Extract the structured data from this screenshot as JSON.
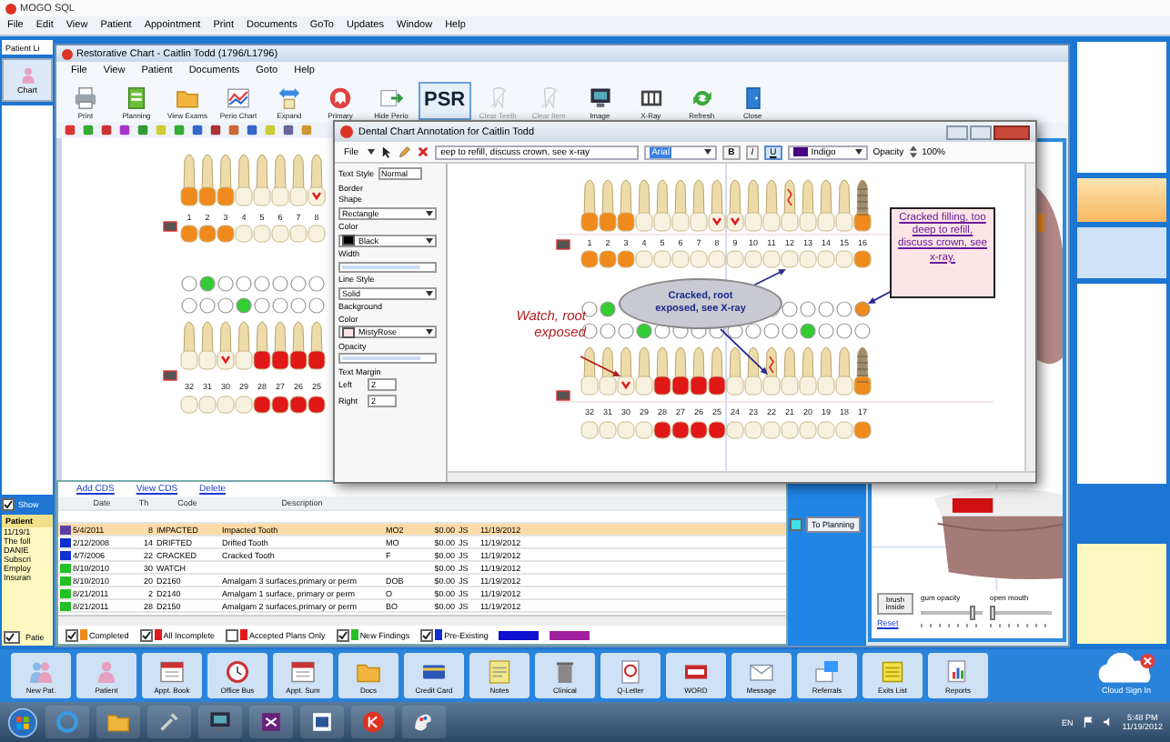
{
  "app": {
    "title": "MOGO SQL",
    "menu": [
      "File",
      "Edit",
      "View",
      "Patient",
      "Appointment",
      "Print",
      "Documents",
      "GoTo",
      "Updates",
      "Window",
      "Help"
    ],
    "side_tab": "Patient Li",
    "chart_button": "Chart",
    "show": {
      "label": "Show",
      "checked": true
    },
    "notes": {
      "header": "Patient",
      "lines": [
        "11/19/1",
        "The foll",
        "DANIE",
        "Subscri",
        "Employ",
        "Insuran"
      ],
      "checkbox": {
        "label": "Patie",
        "checked": true
      }
    },
    "toolbar": [
      "New Pat.",
      "Patient",
      "Appt. Book",
      "Office Bus",
      "Appt. Sum",
      "Docs",
      "Credit Card",
      "Notes",
      "Clinical",
      "Q-Letter",
      "WORD",
      "Message",
      "Referrals",
      "Exits List",
      "Reports"
    ],
    "cloud": "Cloud Sign In"
  },
  "chart_window": {
    "title": "Restorative Chart - Caitlin Todd (1796/L1796)",
    "menu": [
      "File",
      "View",
      "Patient",
      "Documents",
      "Goto",
      "Help"
    ],
    "toolbar": [
      {
        "kind": "icon",
        "label": "Print",
        "disabled": false
      },
      {
        "kind": "icon",
        "label": "Planning",
        "disabled": false
      },
      {
        "kind": "icon",
        "label": "View Exams",
        "disabled": false
      },
      {
        "kind": "icon",
        "label": "Perio Chart",
        "disabled": false
      },
      {
        "kind": "icon",
        "label": "Expand",
        "disabled": false
      },
      {
        "kind": "icon",
        "label": "Primary",
        "disabled": false
      },
      {
        "kind": "icon",
        "label": "Hide Perio",
        "disabled": false
      },
      {
        "kind": "text",
        "label": "PSR",
        "disabled": false
      },
      {
        "kind": "icon",
        "label": "Clear Teeth",
        "disabled": true
      },
      {
        "kind": "icon",
        "label": "Clear Item",
        "disabled": true
      },
      {
        "kind": "icon",
        "label": "Image",
        "disabled": false
      },
      {
        "kind": "icon",
        "label": "X-Ray",
        "disabled": false
      },
      {
        "kind": "icon",
        "label": "Refresh",
        "disabled": false
      },
      {
        "kind": "icon",
        "label": "Close",
        "disabled": false
      }
    ],
    "teeth": {
      "upper": [
        {
          "number": "1",
          "kind": "filling",
          "color": "#ffffff"
        },
        {
          "number": "2",
          "kind": "filling",
          "color": "#33cc33"
        },
        {
          "number": "3",
          "kind": "filling",
          "color": "#ffffff"
        },
        {
          "number": "4",
          "kind": "plain",
          "color": "#ffffff"
        },
        {
          "number": "5",
          "kind": "plain",
          "color": "#ffffff"
        },
        {
          "number": "6",
          "kind": "plain",
          "color": "#ffffff"
        },
        {
          "number": "7",
          "kind": "plain",
          "color": "#ffffff"
        },
        {
          "number": "8",
          "kind": "check",
          "color": "#ffffff"
        }
      ],
      "lower": [
        {
          "number": "32",
          "kind": "plain",
          "color": "#ffffff"
        },
        {
          "number": "31",
          "kind": "plain",
          "color": "#ffffff"
        },
        {
          "number": "30",
          "kind": "check",
          "color": "#ffffff"
        },
        {
          "number": "29",
          "kind": "plain",
          "color": "#33cc33"
        },
        {
          "number": "28",
          "kind": "crown",
          "color": "#ffffff"
        },
        {
          "number": "27",
          "kind": "crown",
          "color": "#ffffff"
        },
        {
          "number": "26",
          "kind": "crown",
          "color": "#ffffff"
        },
        {
          "number": "25",
          "kind": "crown",
          "color": "#ffffff"
        }
      ]
    },
    "links": [
      "Add CDS",
      "View CDS",
      "Delete"
    ],
    "table": {
      "columns": [
        "Date",
        "Th",
        "Code",
        "Description"
      ],
      "rows": [
        {
          "color": "#5b3fa8",
          "selected": true,
          "date": "5/4/2011",
          "tooth": "8",
          "code": "IMPACTED",
          "description": "Impacted Tooth",
          "surface": "MO2",
          "fee": "$0.00",
          "provider": "JS",
          "entered": "11/19/2012"
        },
        {
          "color": "#1030d0",
          "selected": false,
          "date": "2/12/2008",
          "tooth": "14",
          "code": "DRIFTED",
          "description": "Drifted Tooth",
          "surface": "MO",
          "fee": "$0.00",
          "provider": "JS",
          "entered": "11/19/2012"
        },
        {
          "color": "#1030d0",
          "selected": false,
          "date": "4/7/2006",
          "tooth": "22",
          "code": "CRACKED",
          "description": "Cracked Tooth",
          "surface": "F",
          "fee": "$0.00",
          "provider": "JS",
          "entered": "11/19/2012"
        },
        {
          "color": "#22c022",
          "selected": false,
          "date": "8/10/2010",
          "tooth": "30",
          "code": "WATCH",
          "fee": "$0.00",
          "provider": "JS",
          "entered": "11/19/2012"
        },
        {
          "color": "#22c022",
          "selected": false,
          "date": "8/10/2010",
          "tooth": "20",
          "code": "D2160",
          "description": "Amalgam 3 surfaces,primary or perm",
          "surface": "DOB",
          "fee": "$0.00",
          "provider": "JS",
          "entered": "11/19/2012"
        },
        {
          "color": "#22c022",
          "selected": false,
          "date": "8/21/2011",
          "tooth": "2",
          "code": "D2140",
          "description": "Amalgam 1 surface, primary or perm",
          "surface": "O",
          "fee": "$0.00",
          "provider": "JS",
          "entered": "11/19/2012"
        },
        {
          "color": "#22c022",
          "selected": false,
          "date": "8/21/2011",
          "tooth": "28",
          "code": "D2150",
          "description": "Amalgam 2 surfaces,primary or perm",
          "surface": "BO",
          "fee": "$0.00",
          "provider": "JS",
          "entered": "11/19/2012"
        }
      ]
    },
    "legend": [
      {
        "label": "Completed",
        "checked": true,
        "color": "#f08a1c"
      },
      {
        "label": "All Incomplete",
        "checked": true,
        "color": "#e01818"
      },
      {
        "label": "Accepted Plans Only",
        "checked": false,
        "color": "#e01818"
      },
      {
        "label": "New Findings",
        "checked": true,
        "color": "#22c022"
      },
      {
        "label": "Pre-Existing",
        "checked": true,
        "color": "#1030d0"
      }
    ],
    "legend_swatches": [
      {
        "color": "#1010d0"
      },
      {
        "color": "#a020a0"
      }
    ],
    "to_planning": {
      "label": "To Planning",
      "checked": false
    },
    "model": {
      "button": "brush inside",
      "sliders": [
        {
          "label": "gum opacity",
          "level": 0.85
        },
        {
          "label": "open mouth",
          "level": 0.05
        }
      ],
      "reset": "Reset"
    }
  },
  "annotation_window": {
    "title": "Dental Chart Annotation for Caitlin Todd",
    "toolbar": {
      "file": "File",
      "text": "eep to refill, discuss crown, see x-ray",
      "font": "Arial",
      "bold": "B",
      "italic": "I",
      "underline": "U",
      "underline_on": true,
      "color_name": "Indigo",
      "color": "#4b0082",
      "opacity_label": "Opacity",
      "opacity": "100%"
    },
    "properties": [
      {
        "kind": "pair",
        "text": "Text Style",
        "value": "Normal"
      },
      {
        "kind": "label",
        "text": "Border"
      },
      {
        "kind": "label",
        "text": "Shape"
      },
      {
        "kind": "select",
        "text": "Rectangle"
      },
      {
        "kind": "label",
        "text": "Color"
      },
      {
        "kind": "select",
        "text": "Black",
        "color": "#000000"
      },
      {
        "kind": "label",
        "text": "Width"
      },
      {
        "kind": "bar"
      },
      {
        "kind": "label",
        "text": "Line Style"
      },
      {
        "kind": "select",
        "text": "Solid"
      },
      {
        "kind": "label",
        "text": "Background"
      },
      {
        "kind": "label",
        "text": "Color"
      },
      {
        "kind": "select",
        "text": "MistyRose",
        "color": "#ffe4e1"
      },
      {
        "kind": "label",
        "text": "Opacity"
      },
      {
        "kind": "bar"
      },
      {
        "kind": "label",
        "text": "Text Margin"
      },
      {
        "kind": "spin",
        "text": "Left",
        "value": "2"
      },
      {
        "kind": "spin",
        "text": "Right",
        "value": "2"
      }
    ],
    "teeth": {
      "upper": [
        {
          "number": "1",
          "kind": "filling",
          "color": "#ffffff"
        },
        {
          "number": "2",
          "kind": "filling",
          "color": "#33cc33"
        },
        {
          "number": "3",
          "kind": "filling"
        },
        {
          "number": "4",
          "kind": "plain"
        },
        {
          "number": "5",
          "kind": "plain"
        },
        {
          "number": "6",
          "kind": "plain"
        },
        {
          "number": "7",
          "kind": "plain"
        },
        {
          "number": "8",
          "kind": "check"
        },
        {
          "number": "9",
          "kind": "check"
        },
        {
          "number": "10",
          "kind": "plain"
        },
        {
          "number": "11",
          "kind": "plain",
          "color": "#ffffff"
        },
        {
          "number": "12",
          "kind": "crack",
          "color": "#ffffff"
        },
        {
          "number": "13",
          "kind": "plain",
          "color": "#ffffff"
        },
        {
          "number": "14",
          "kind": "plain",
          "color": "#ffffff"
        },
        {
          "number": "15",
          "kind": "plain",
          "color": "#ffffff"
        },
        {
          "number": "16",
          "kind": "implant",
          "color": "#f08a1c"
        }
      ],
      "lower": [
        {
          "number": "32",
          "kind": "plain",
          "color": "#ffffff"
        },
        {
          "number": "31",
          "kind": "plain",
          "color": "#ffffff"
        },
        {
          "number": "30",
          "kind": "check",
          "color": "#ffffff"
        },
        {
          "number": "29",
          "kind": "plain",
          "color": "#33cc33"
        },
        {
          "number": "28",
          "kind": "crown",
          "color": "#ffffff"
        },
        {
          "number": "27",
          "kind": "crown",
          "color": "#ffffff"
        },
        {
          "number": "26",
          "kind": "crown",
          "color": "#ffffff"
        },
        {
          "number": "25",
          "kind": "crown",
          "color": "#ffffff"
        },
        {
          "number": "24",
          "kind": "plain",
          "color": "#ffffff"
        },
        {
          "number": "23",
          "kind": "plain",
          "color": "#ffffff"
        },
        {
          "number": "22",
          "kind": "crack",
          "color": "#ffffff"
        },
        {
          "number": "21",
          "kind": "plain",
          "color": "#ffffff"
        },
        {
          "number": "20",
          "kind": "plain",
          "color": "#33cc33"
        },
        {
          "number": "19",
          "kind": "plain",
          "color": "#ffffff"
        },
        {
          "number": "18",
          "kind": "plain",
          "color": "#ffffff"
        },
        {
          "number": "17",
          "kind": "implant",
          "color": "#ffffff"
        }
      ]
    },
    "annotations": [
      {
        "kind": "box",
        "text": "Cracked filling, too deep to refill, discuss crown, see x-ray.",
        "color": "#6a1b9a"
      },
      {
        "kind": "ellipse",
        "text": "Cracked, root exposed, see X-ray",
        "color": "#1a2a8a"
      },
      {
        "kind": "note",
        "text": "Watch, root exposed",
        "color": "#b01c1c"
      }
    ]
  },
  "taskbar": {
    "language": "EN",
    "time": "5:48 PM",
    "date": "11/19/2012"
  }
}
